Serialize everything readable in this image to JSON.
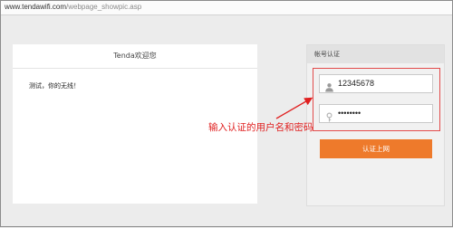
{
  "browser": {
    "url_prefix": "www.tendawifi.com",
    "url_suffix": "/webpage_showpic.asp"
  },
  "welcome": {
    "title": "Tenda欢迎您",
    "message": "测试，你的无线！"
  },
  "auth": {
    "title": "帐号认证",
    "username_value": "12345678",
    "password_value": "••••••••",
    "submit_label": "认证上网"
  },
  "annotation": {
    "text": "输入认证的用户名和密码",
    "color": "#e02020"
  },
  "colors": {
    "accent_button": "#ee7a2b",
    "highlight": "#e24b4b"
  },
  "icons": {
    "username": "user-icon",
    "password": "key-icon"
  }
}
